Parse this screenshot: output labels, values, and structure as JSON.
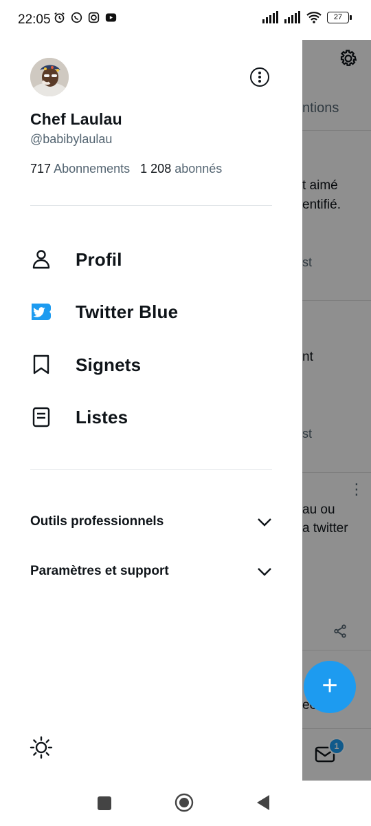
{
  "status_bar": {
    "time": "22:05",
    "battery": "27",
    "left_icons": [
      "alarm-icon",
      "whatsapp-icon",
      "instagram-icon",
      "youtube-icon"
    ],
    "right_icons": [
      "signal-icon",
      "signal-icon",
      "wifi-icon",
      "battery-icon"
    ]
  },
  "drawer": {
    "profile": {
      "name": "Chef Laulau",
      "handle": "@babibylaulau",
      "following_count": "717",
      "following_label": "Abonnements",
      "followers_count": "1 208",
      "followers_label": "abonnés"
    },
    "menu": [
      {
        "label": "Profil",
        "icon": "person-icon"
      },
      {
        "label": "Twitter Blue",
        "icon": "twitter-blue-icon"
      },
      {
        "label": "Signets",
        "icon": "bookmark-icon"
      },
      {
        "label": "Listes",
        "icon": "list-icon"
      }
    ],
    "sections": [
      {
        "label": "Outils professionnels"
      },
      {
        "label": "Paramètres et support"
      }
    ]
  },
  "background": {
    "tab_label": "ntions",
    "texts": [
      "t aimé",
      "entifié.",
      "st",
      "nt",
      "st",
      "au ou",
      "a twitter",
      "eets ns"
    ],
    "badge": "1"
  },
  "colors": {
    "accent": "#1d9bf0",
    "text_primary": "#0f1419",
    "text_secondary": "#536471"
  }
}
